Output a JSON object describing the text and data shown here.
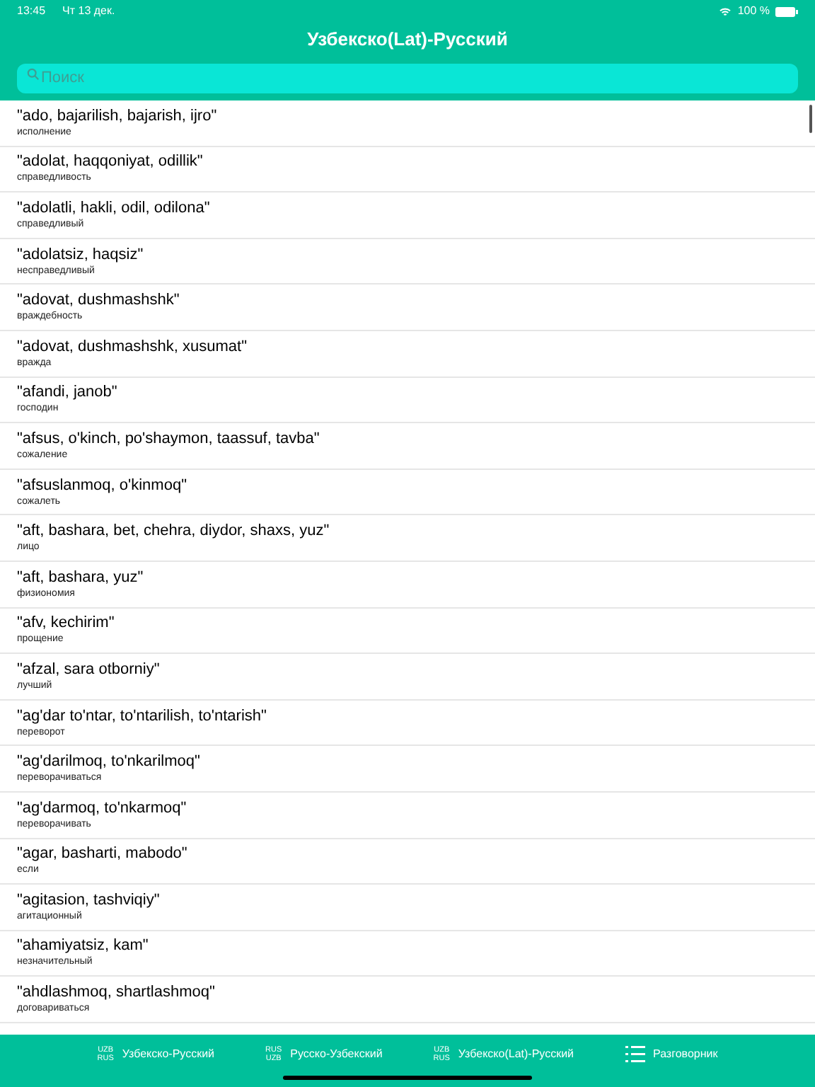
{
  "status_bar": {
    "time": "13:45",
    "date": "Чт 13 дек.",
    "battery": "100 %"
  },
  "title": "Узбекско(Lat)-Русский",
  "search": {
    "placeholder": "Поиск"
  },
  "entries": [
    {
      "word": "\"ado, bajarilish, bajarish, ijro\"",
      "translation": "исполнение"
    },
    {
      "word": "\"adolat, haqqoniyat, odillik\"",
      "translation": "справедливость"
    },
    {
      "word": "\"adolatli, hakli, odil, odilona\"",
      "translation": "справедливый"
    },
    {
      "word": "\"adolatsiz, haqsiz\"",
      "translation": "несправедливый"
    },
    {
      "word": "\"adovat, dushmashshk\"",
      "translation": "враждебность"
    },
    {
      "word": "\"adovat, dushmashshk, xusumat\"",
      "translation": "вражда"
    },
    {
      "word": "\"afandi, janob\"",
      "translation": "господин"
    },
    {
      "word": "\"afsus, o'kinch, po'shaymon, taassuf, tavba\"",
      "translation": "сожаление"
    },
    {
      "word": "\"afsuslanmoq, o'kinmoq\"",
      "translation": "сожалеть"
    },
    {
      "word": "\"aft, bashara, bet, chehra, diydor, shaxs, yuz\"",
      "translation": "лицо"
    },
    {
      "word": "\"aft, bashara, yuz\"",
      "translation": "физиономия"
    },
    {
      "word": "\"afv, kechirim\"",
      "translation": "прощение"
    },
    {
      "word": "\"afzal, sara otborniy\"",
      "translation": "лучший"
    },
    {
      "word": "\"ag'dar to'ntar, to'ntarilish, to'ntarish\"",
      "translation": "переворот"
    },
    {
      "word": "\"ag'darilmoq, to'nkarilmoq\"",
      "translation": "переворачиваться"
    },
    {
      "word": "\"ag'darmoq, to'nkarmoq\"",
      "translation": "переворачивать"
    },
    {
      "word": "\"agar, basharti, mabodo\"",
      "translation": "если"
    },
    {
      "word": "\"agitasion, tashviqiy\"",
      "translation": "агитационный"
    },
    {
      "word": "\"ahamiyatsiz, kam\"",
      "translation": "незначительный"
    },
    {
      "word": "\"ahdlashmoq, shartlashmoq\"",
      "translation": "договариваться"
    }
  ],
  "tabs": [
    {
      "kind": "lang",
      "codes": [
        "UZB",
        "RUS"
      ],
      "label": "Узбекско-Русский"
    },
    {
      "kind": "lang",
      "codes": [
        "RUS",
        "UZB"
      ],
      "label": "Русско-Узбекский"
    },
    {
      "kind": "lang",
      "codes": [
        "UZB",
        "RUS"
      ],
      "label": "Узбекско(Lat)-Русский"
    },
    {
      "kind": "list",
      "label": "Разговорник"
    }
  ]
}
